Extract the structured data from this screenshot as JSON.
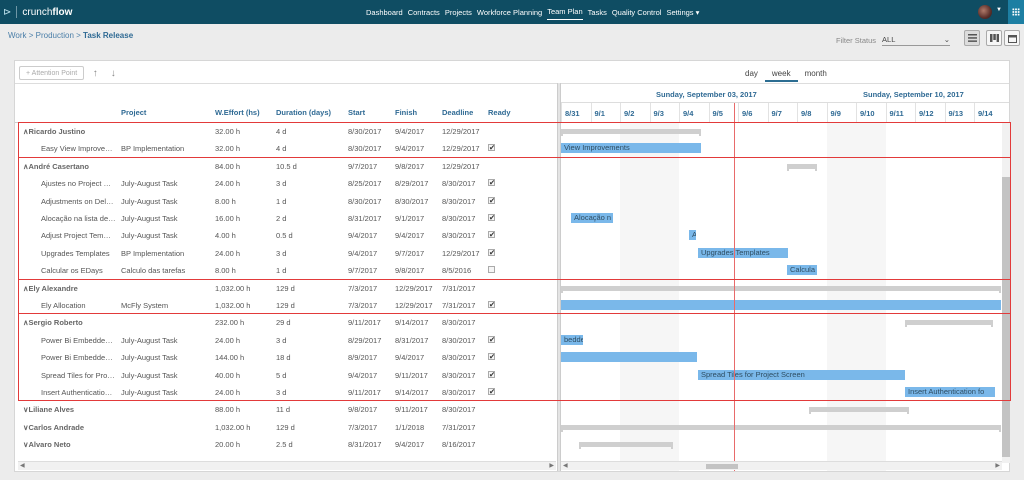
{
  "topbar": {
    "brand_light": "crunch",
    "brand_bold": "flow",
    "nav": [
      "Dashboard",
      "Contracts",
      "Projects",
      "Workforce Planning",
      "Team Plan",
      "Tasks",
      "Quality Control",
      "Settings ▾"
    ],
    "active_nav": "Team Plan",
    "colors": {
      "bar": "#0f4d63",
      "accent": "#1d7fa3"
    }
  },
  "breadcrumb": {
    "work": "Work",
    "sep": " > ",
    "production": "Production",
    "current": "Task Release"
  },
  "filter": {
    "label": "Filter Status",
    "value": "ALL"
  },
  "toolbar": {
    "attention_point": "+ Attention Point"
  },
  "scale": {
    "options": [
      "day",
      "week",
      "month"
    ],
    "active": "week"
  },
  "columns": {
    "project": "Project",
    "effort": "W.Effort (hs)",
    "duration": "Duration (days)",
    "start": "Start",
    "finish": "Finish",
    "deadline": "Deadline",
    "ready": "Ready"
  },
  "rows": [
    {
      "g": true,
      "name": "∧Ricardo Justino",
      "project": "",
      "effort": "32.00 h",
      "duration": "4 d",
      "start": "8/30/2017",
      "finish": "9/4/2017",
      "deadline": "12/29/2017",
      "ready": null
    },
    {
      "g": false,
      "name": "Easy View Improve…",
      "project": "BP Implementation",
      "effort": "32.00 h",
      "duration": "4 d",
      "start": "8/30/2017",
      "finish": "9/4/2017",
      "deadline": "12/29/2017",
      "ready": true
    },
    {
      "g": true,
      "name": "∧André Casertano",
      "project": "",
      "effort": "84.00 h",
      "duration": "10.5 d",
      "start": "9/7/2017",
      "finish": "9/8/2017",
      "deadline": "12/29/2017",
      "ready": null
    },
    {
      "g": false,
      "name": "Ajustes no Project …",
      "project": "July-August Task",
      "effort": "24.00 h",
      "duration": "3 d",
      "start": "8/25/2017",
      "finish": "8/29/2017",
      "deadline": "8/30/2017",
      "ready": true
    },
    {
      "g": false,
      "name": "Adjustments on Del…",
      "project": "July-August Task",
      "effort": "8.00 h",
      "duration": "1 d",
      "start": "8/30/2017",
      "finish": "8/30/2017",
      "deadline": "8/30/2017",
      "ready": true
    },
    {
      "g": false,
      "name": "Alocação na lista de…",
      "project": "July-August Task",
      "effort": "16.00 h",
      "duration": "2 d",
      "start": "8/31/2017",
      "finish": "9/1/2017",
      "deadline": "8/30/2017",
      "ready": true
    },
    {
      "g": false,
      "name": "Adjust Project Tem…",
      "project": "July-August Task",
      "effort": "4.00 h",
      "duration": "0.5 d",
      "start": "9/4/2017",
      "finish": "9/4/2017",
      "deadline": "8/30/2017",
      "ready": true
    },
    {
      "g": false,
      "name": "Upgrades Templates",
      "project": "BP Implementation",
      "effort": "24.00 h",
      "duration": "3 d",
      "start": "9/4/2017",
      "finish": "9/7/2017",
      "deadline": "12/29/2017",
      "ready": true
    },
    {
      "g": false,
      "name": "Calcular os EDays",
      "project": "Calculo das tarefas",
      "effort": "8.00 h",
      "duration": "1 d",
      "start": "9/7/2017",
      "finish": "9/8/2017",
      "deadline": "8/5/2016",
      "ready": false
    },
    {
      "g": true,
      "name": "∧Ely Alexandre",
      "project": "",
      "effort": "1,032.00 h",
      "duration": "129 d",
      "start": "7/3/2017",
      "finish": "12/29/2017",
      "deadline": "7/31/2017",
      "ready": null
    },
    {
      "g": false,
      "name": "Ely Allocation",
      "project": "McFly System",
      "effort": "1,032.00 h",
      "duration": "129 d",
      "start": "7/3/2017",
      "finish": "12/29/2017",
      "deadline": "7/31/2017",
      "ready": true
    },
    {
      "g": true,
      "name": "∧Sergio Roberto",
      "project": "",
      "effort": "232.00 h",
      "duration": "29 d",
      "start": "9/11/2017",
      "finish": "9/14/2017",
      "deadline": "8/30/2017",
      "ready": null
    },
    {
      "g": false,
      "name": "Power Bi Embedde…",
      "project": "July-August Task",
      "effort": "24.00 h",
      "duration": "3 d",
      "start": "8/29/2017",
      "finish": "8/31/2017",
      "deadline": "8/30/2017",
      "ready": true
    },
    {
      "g": false,
      "name": "Power Bi Embedde…",
      "project": "July-August Task",
      "effort": "144.00 h",
      "duration": "18 d",
      "start": "8/9/2017",
      "finish": "9/4/2017",
      "deadline": "8/30/2017",
      "ready": true
    },
    {
      "g": false,
      "name": "Spread Tiles for Pro…",
      "project": "July-August Task",
      "effort": "40.00 h",
      "duration": "5 d",
      "start": "9/4/2017",
      "finish": "9/11/2017",
      "deadline": "8/30/2017",
      "ready": true
    },
    {
      "g": false,
      "name": "Insert Authenticatio…",
      "project": "July-August Task",
      "effort": "24.00 h",
      "duration": "3 d",
      "start": "9/11/2017",
      "finish": "9/14/2017",
      "deadline": "8/30/2017",
      "ready": true
    },
    {
      "g": true,
      "name": "∨Liliane Alves",
      "project": "",
      "effort": "88.00 h",
      "duration": "11 d",
      "start": "9/8/2017",
      "finish": "9/11/2017",
      "deadline": "8/30/2017",
      "ready": null
    },
    {
      "g": true,
      "name": "∨Carlos Andrade",
      "project": "",
      "effort": "1,032.00 h",
      "duration": "129 d",
      "start": "7/3/2017",
      "finish": "1/1/2018",
      "deadline": "7/31/2017",
      "ready": null
    },
    {
      "g": true,
      "name": "∨Alvaro Neto",
      "project": "",
      "effort": "20.00 h",
      "duration": "2.5 d",
      "start": "8/31/2017",
      "finish": "9/4/2017",
      "deadline": "8/16/2017",
      "ready": null
    }
  ],
  "gantt": {
    "week_labels": [
      "Sunday, September 03, 2017",
      "Sunday, September 10, 2017"
    ],
    "days": [
      "8/31",
      "9/1",
      "9/2",
      "9/3",
      "9/4",
      "9/5",
      "9/6",
      "9/7",
      "9/8",
      "9/9",
      "9/10",
      "9/11",
      "9/12",
      "9/13",
      "9/14"
    ],
    "bars": [
      {
        "row": 1,
        "label": "View Improvements"
      },
      {
        "row": 5,
        "label": "Alocação n"
      },
      {
        "row": 6,
        "label": "A"
      },
      {
        "row": 7,
        "label": "Upgrades Templates"
      },
      {
        "row": 8,
        "label": "Calcula"
      },
      {
        "row": 10,
        "label": ""
      },
      {
        "row": 12,
        "label": "bedde"
      },
      {
        "row": 13,
        "label": ""
      },
      {
        "row": 14,
        "label": "Spread Tiles for Project Screen"
      },
      {
        "row": 15,
        "label": "Insert Authentication fo"
      }
    ]
  }
}
